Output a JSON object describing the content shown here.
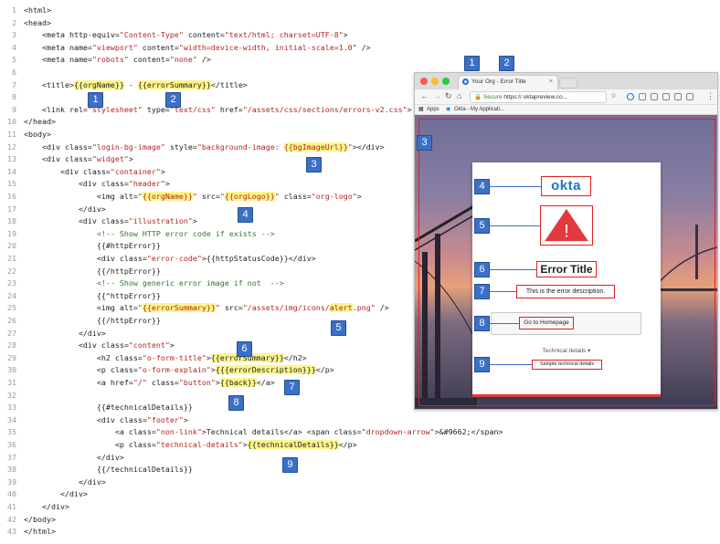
{
  "code": {
    "lines": [
      [
        "1",
        "<html>"
      ],
      [
        "2",
        "<head>"
      ],
      [
        "3",
        "    <meta http-equiv=\"Content-Type\" content=\"text/html; charset=UTF-8\">"
      ],
      [
        "4",
        "    <meta name=\"viewport\" content=\"width=device-width, initial-scale=1.0\" />"
      ],
      [
        "5",
        "    <meta name=\"robots\" content=\"none\" />"
      ],
      [
        "6",
        ""
      ],
      [
        "7",
        "    <title>{{orgName}} - {{errorSummary}}</title>"
      ],
      [
        "8",
        ""
      ],
      [
        "9",
        "    <link rel=\"stylesheet\" type=\"text/css\" href=\"/assets/css/sections/errors-v2.css\">"
      ],
      [
        "10",
        "</head>"
      ],
      [
        "11",
        "<body>"
      ],
      [
        "12",
        "    <div class=\"login-bg-image\" style=\"background-image: {{bgImageUrl}}\"></div>"
      ],
      [
        "13",
        "    <div class=\"widget\">"
      ],
      [
        "14",
        "        <div class=\"container\">"
      ],
      [
        "15",
        "            <div class=\"header\">"
      ],
      [
        "16",
        "                <img alt=\"{{orgName}}\" src=\"{{orgLogo}}\" class=\"org-logo\">"
      ],
      [
        "17",
        "            </div>"
      ],
      [
        "18",
        "            <div class=\"illustration\">"
      ],
      [
        "19",
        "                <!-- Show HTTP error code if exists -->"
      ],
      [
        "20",
        "                {{#httpError}}"
      ],
      [
        "21",
        "                <div class=\"error-code\">{{httpStatusCode}}</div>"
      ],
      [
        "22",
        "                {{/httpError}}"
      ],
      [
        "23",
        "                <!-- Show generic error image if not  -->"
      ],
      [
        "24",
        "                {{^httpError}}"
      ],
      [
        "25",
        "                <img alt=\"{{errorSummary}}\" src=\"/assets/img/icons/alert.png\" />"
      ],
      [
        "26",
        "                {{/httpError}}"
      ],
      [
        "27",
        "            </div>"
      ],
      [
        "28",
        "            <div class=\"content\">"
      ],
      [
        "29",
        "                <h2 class=\"o-form-title\">{{errorSummary}}</h2>"
      ],
      [
        "30",
        "                <p class=\"o-form-explain\">{{{errorDescription}}}</p>"
      ],
      [
        "31",
        "                <a href=\"/\" class=\"button\">{{back}}</a>"
      ],
      [
        "32",
        ""
      ],
      [
        "33",
        "                {{#technicalDetails}}"
      ],
      [
        "34",
        "                <div class=\"footer\">"
      ],
      [
        "35",
        "                    <a class=\"non-link\">Technical details</a> <span class=\"dropdown-arrow\">&#9662;</span>"
      ],
      [
        "36",
        "                    <p class=\"technical-details\">{{technicalDetails}}</p>"
      ],
      [
        "37",
        "                </div>"
      ],
      [
        "38",
        "                {{/technicalDetails}}"
      ],
      [
        "39",
        "            </div>"
      ],
      [
        "40",
        "        </div>"
      ],
      [
        "41",
        "    </div>"
      ],
      [
        "42",
        "</body>"
      ],
      [
        "43",
        "</html>"
      ]
    ],
    "highlights": [
      "{{orgName}}",
      "{{errorSummary}}",
      "{{bgImageUrl}}",
      "{{orgLogo}}",
      "alert",
      "{{{errorDescription}}}",
      "{{back}}",
      "{{technicalDetails}}"
    ]
  },
  "markers": {
    "m1": "1",
    "m2": "2",
    "m3": "3",
    "m4": "4",
    "m5": "5",
    "m6": "6",
    "m7": "7",
    "m8": "8",
    "m9": "9"
  },
  "browser": {
    "tab_title": "Your Org - Error Title",
    "tab_close": "×",
    "secure_label": "Secure",
    "url": "https://                     oktapreview.co...",
    "bookmarks": [
      "Apps",
      "Okta - My Applicati..."
    ],
    "markers": [
      "1",
      "2",
      "3",
      "4",
      "5",
      "6",
      "7",
      "8",
      "9"
    ]
  },
  "widget": {
    "logo": "okta",
    "alert_glyph": "!",
    "title": "Error Title",
    "description": "This is the error description.",
    "button_label": "Go to Homepage",
    "technical_details_label": "Technical details ▾",
    "technical_details": "Sample technical details"
  },
  "colors": {
    "marker_blue": "#3c6fc6",
    "highlight_yellow": "#fdf58a",
    "annotation_red": "#e02020",
    "okta_blue": "#1f74c8"
  }
}
